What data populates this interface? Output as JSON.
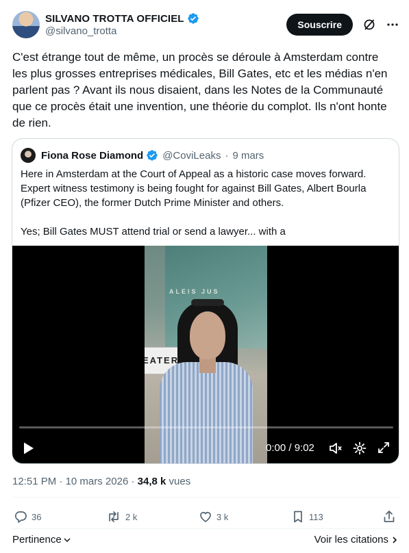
{
  "author": {
    "display_name": "SILVANO TROTTA OFFICIEL",
    "handle": "@silvano_trotta",
    "verified": true,
    "avatar_icon": "profile-photo"
  },
  "header": {
    "subscribe_label": "Souscrire",
    "grok_icon": "grok-icon",
    "more_icon": "more-dots-icon"
  },
  "tweet": {
    "text": "C'est étrange tout de même, un procès se déroule à Amsterdam contre les plus grosses entreprises médicales, Bill Gates, etc et les médias n'en parlent pas ? Avant ils nous disaient, dans les Notes de la Communauté que ce procès était une invention, une théorie du complot. Ils n'ont honte de rien."
  },
  "quote": {
    "display_name": "Fiona Rose Diamond",
    "handle": "@CoviLeaks",
    "separator": "·",
    "date": "9 mars",
    "verified": true,
    "text": "Here in Amsterdam at the Court of Appeal as a historic case moves forward. Expert witness testimony is being fought for against Bill Gates, Albert Bourla (Pfizer CEO), the former Dutch Prime Minister and others.\n\nYes; Bill Gates MUST attend trial or send a lawyer... with a",
    "video": {
      "timecode": "0:00 / 9:02",
      "progress": 0,
      "building_text": "ALEIS JUS",
      "banner_text": "EATER"
    }
  },
  "meta": {
    "time": "12:51 PM",
    "separator": "·",
    "date": "10 mars 2026",
    "separator2": "·",
    "views_count": "34,8 k",
    "views_label": "vues"
  },
  "actions": {
    "replies": "36",
    "reposts": "2 k",
    "likes": "3 k",
    "bookmarks": "113"
  },
  "footer": {
    "sort_label": "Pertinence",
    "quotes_label": "Voir les citations"
  },
  "colors": {
    "primary_text": "#0f1419",
    "secondary_text": "#536471",
    "verified_blue": "#1d9bf0",
    "border": "#cfd9de"
  }
}
